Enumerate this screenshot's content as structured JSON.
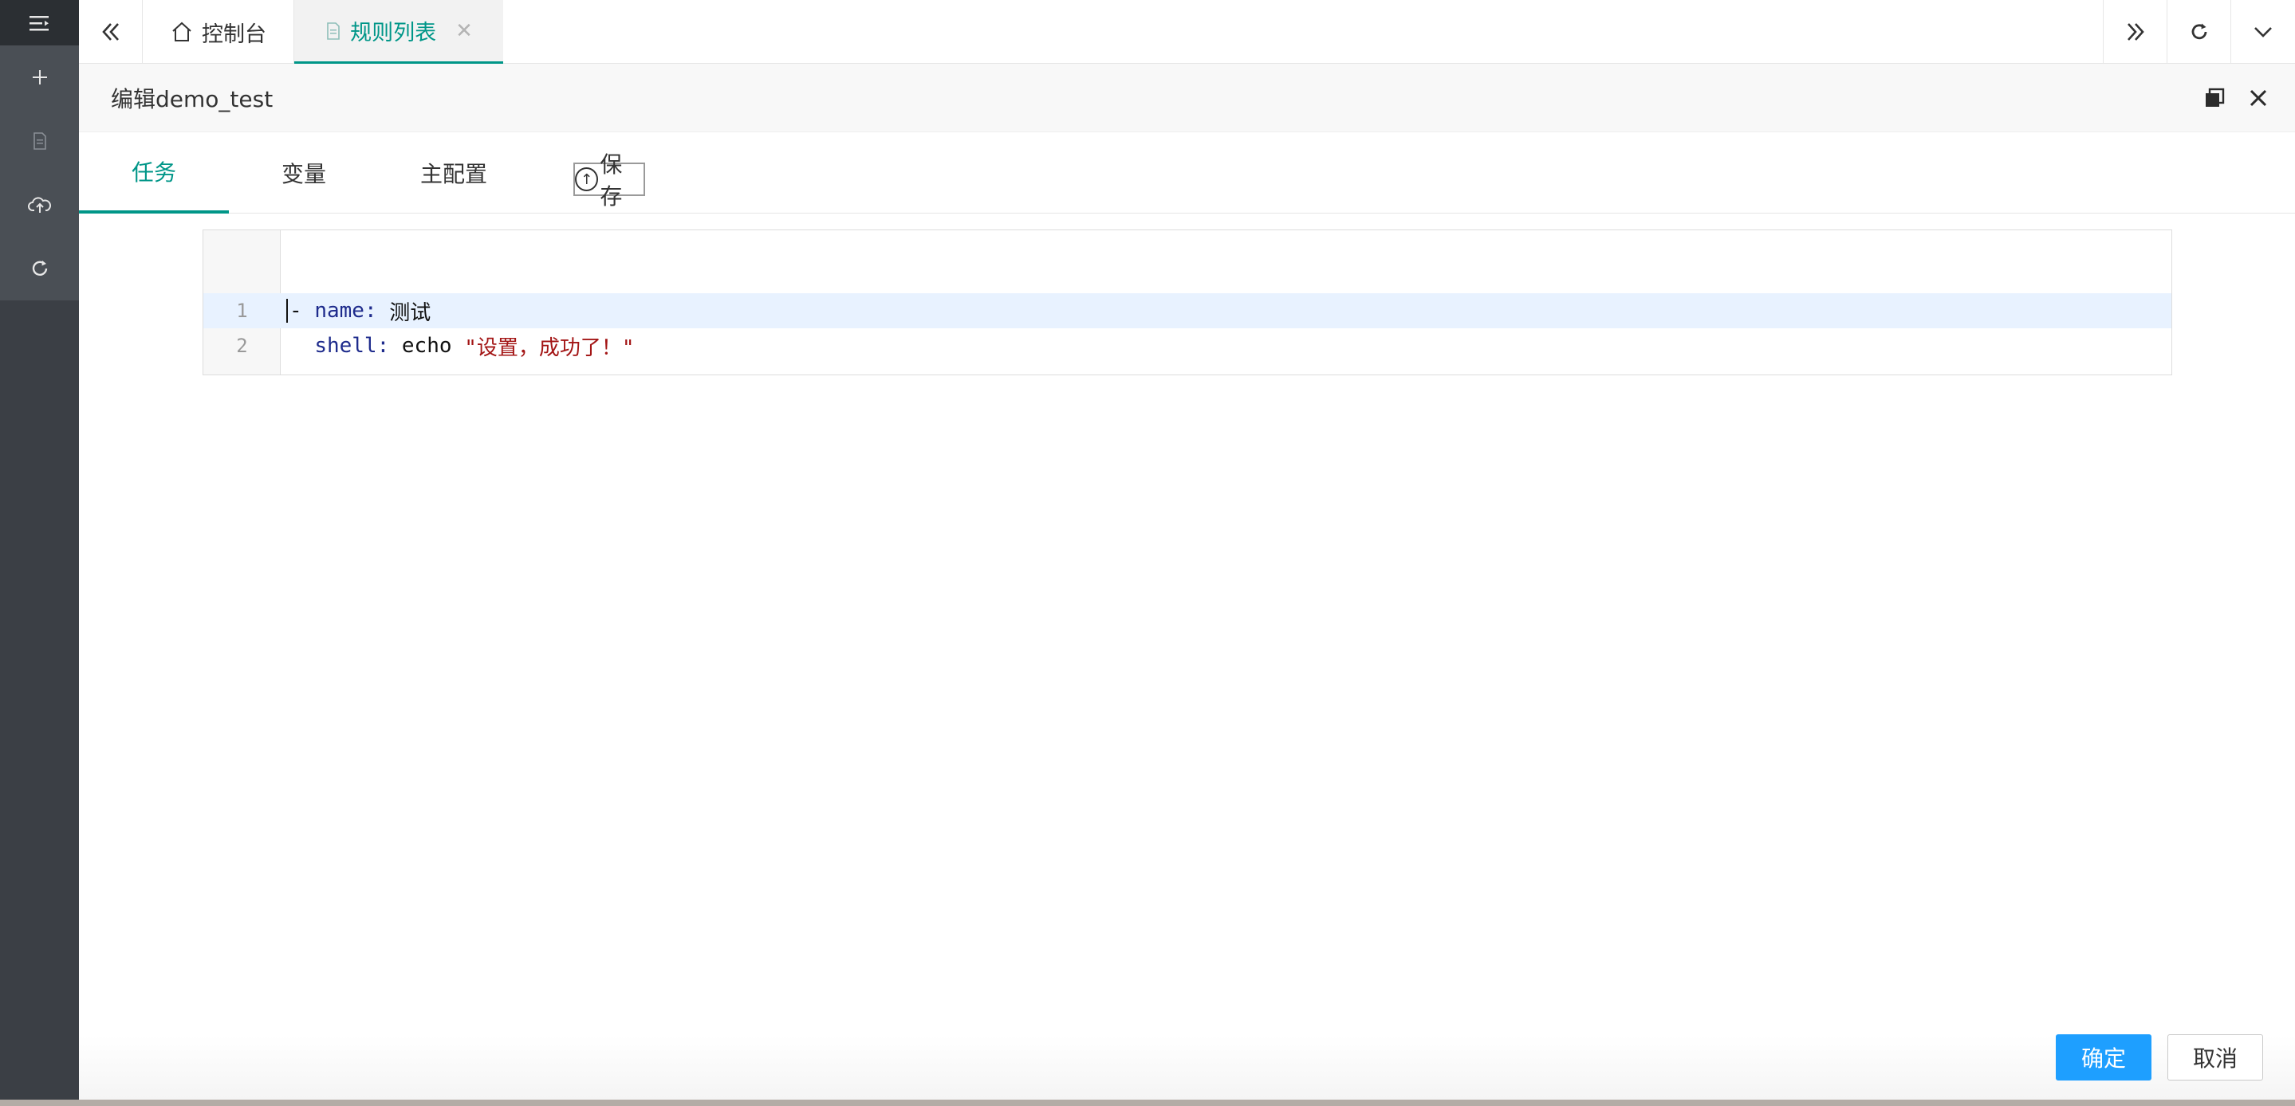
{
  "sidebar": {
    "items": [
      {
        "icon": "menu-collapse-icon"
      },
      {
        "icon": "plus-icon"
      },
      {
        "icon": "document-icon"
      },
      {
        "icon": "cloud-upload-icon"
      },
      {
        "icon": "refresh-icon"
      }
    ]
  },
  "topbar": {
    "tabs": [
      {
        "label": "控制台",
        "icon": "home-icon"
      },
      {
        "label": "规则列表",
        "icon": "document-icon",
        "active": true
      }
    ]
  },
  "dialog": {
    "title": "编辑demo_test",
    "tabs": [
      {
        "label": "任务",
        "active": true
      },
      {
        "label": "变量"
      },
      {
        "label": "主配置"
      }
    ],
    "save_label": "保存",
    "editor": {
      "lines": [
        {
          "number": "1",
          "dash": "- ",
          "key": "name",
          "colon": ": ",
          "value": "测试"
        },
        {
          "number": "2",
          "indent": "  ",
          "key": "shell",
          "colon": ": ",
          "value": "echo ",
          "string": "\"设置，成功了！\""
        }
      ]
    },
    "confirm_label": "确定",
    "cancel_label": "取消"
  },
  "colors": {
    "accent": "#009688",
    "primary_button": "#1e9fff",
    "sidebar_bg": "#3b3f45"
  }
}
